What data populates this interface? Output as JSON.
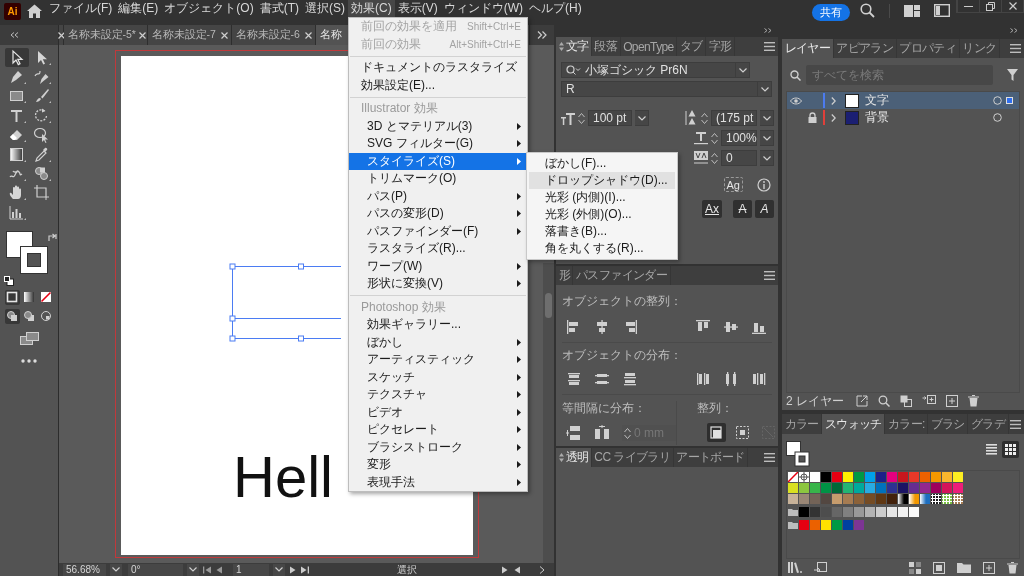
{
  "app": {
    "logo": "Ai"
  },
  "menu_bar": [
    {
      "label": "ファイル(F)",
      "selected": false
    },
    {
      "label": "編集(E)",
      "selected": false
    },
    {
      "label": "オブジェクト(O)",
      "selected": false
    },
    {
      "label": "書式(T)",
      "selected": false
    },
    {
      "label": "選択(S)",
      "selected": false
    },
    {
      "label": "効果(C)",
      "selected": true
    },
    {
      "label": "表示(V)",
      "selected": false
    },
    {
      "label": "ウィンドウ(W)",
      "selected": false
    },
    {
      "label": "ヘルプ(H)",
      "selected": false
    }
  ],
  "share_button": "共有",
  "tools": [
    {
      "kind": "selection",
      "selected": true
    },
    {
      "kind": "direct-selection",
      "selected": false
    },
    {
      "kind": "pen",
      "selected": false
    },
    {
      "kind": "curvature",
      "selected": false
    },
    {
      "kind": "rectangle",
      "selected": false
    },
    {
      "kind": "paintbrush",
      "selected": false
    },
    {
      "kind": "type",
      "selected": false
    },
    {
      "kind": "rotate",
      "selected": false
    },
    {
      "kind": "eraser",
      "selected": false
    },
    {
      "kind": "shaper",
      "selected": false
    },
    {
      "kind": "gradient",
      "selected": false
    },
    {
      "kind": "eyedropper",
      "selected": false
    },
    {
      "kind": "puppet-warp",
      "selected": false
    },
    {
      "kind": "shape-builder",
      "selected": false
    },
    {
      "kind": "hand",
      "selected": false
    },
    {
      "kind": "artboard",
      "selected": false
    },
    {
      "kind": "graph",
      "selected": false
    }
  ],
  "color_modes": [
    {
      "kind": "color",
      "selected": true
    },
    {
      "kind": "gradient",
      "selected": false
    },
    {
      "kind": "none",
      "selected": false
    }
  ],
  "draw_modes": [
    {
      "kind": "normal",
      "selected": true
    },
    {
      "kind": "behind",
      "selected": false
    },
    {
      "kind": "inside",
      "selected": false
    }
  ],
  "document_tabs": [
    {
      "label": "名称未設定-5*",
      "selected": false
    },
    {
      "label": "名称未設定-7",
      "selected": false
    },
    {
      "label": "名称未設定-6",
      "selected": false
    },
    {
      "label": "名称",
      "selected": true
    }
  ],
  "artboard": {
    "text": "Hell"
  },
  "status_bar": {
    "zoom": "56.68%",
    "rotation": "0°",
    "artboard": "1",
    "tool": "選択"
  },
  "effect_menu": {
    "sections": [
      {
        "items": [
          {
            "label": "前回の効果を適用",
            "shortcut": "Shift+Ctrl+E",
            "disabled": true,
            "submenu": false,
            "selected": false
          },
          {
            "label": "前回の効果",
            "shortcut": "Alt+Shift+Ctrl+E",
            "disabled": true,
            "submenu": false,
            "selected": false
          }
        ]
      },
      {
        "items": [
          {
            "label": "ドキュメントのラスタライズ効果設定(E)...",
            "disabled": false,
            "submenu": false,
            "selected": false
          }
        ]
      },
      {
        "header": "Illustrator 効果",
        "items": [
          {
            "label": "3D とマテリアル(3)",
            "disabled": false,
            "submenu": true,
            "selected": false
          },
          {
            "label": "SVG フィルター(G)",
            "disabled": false,
            "submenu": true,
            "selected": false
          },
          {
            "label": "スタイライズ(S)",
            "disabled": false,
            "submenu": true,
            "selected": true
          },
          {
            "label": "トリムマーク(O)",
            "disabled": false,
            "submenu": false,
            "selected": false
          },
          {
            "label": "パス(P)",
            "disabled": false,
            "submenu": true,
            "selected": false
          },
          {
            "label": "パスの変形(D)",
            "disabled": false,
            "submenu": true,
            "selected": false
          },
          {
            "label": "パスファインダー(F)",
            "disabled": false,
            "submenu": true,
            "selected": false
          },
          {
            "label": "ラスタライズ(R)...",
            "disabled": false,
            "submenu": false,
            "selected": false
          },
          {
            "label": "ワープ(W)",
            "disabled": false,
            "submenu": true,
            "selected": false
          },
          {
            "label": "形状に変換(V)",
            "disabled": false,
            "submenu": true,
            "selected": false
          }
        ]
      },
      {
        "header": "Photoshop 効果",
        "items": [
          {
            "label": "効果ギャラリー...",
            "disabled": false,
            "submenu": false,
            "selected": false
          },
          {
            "label": "ぼかし",
            "disabled": false,
            "submenu": true,
            "selected": false
          },
          {
            "label": "アーティスティック",
            "disabled": false,
            "submenu": true,
            "selected": false
          },
          {
            "label": "スケッチ",
            "disabled": false,
            "submenu": true,
            "selected": false
          },
          {
            "label": "テクスチャ",
            "disabled": false,
            "submenu": true,
            "selected": false
          },
          {
            "label": "ビデオ",
            "disabled": false,
            "submenu": true,
            "selected": false
          },
          {
            "label": "ピクセレート",
            "disabled": false,
            "submenu": true,
            "selected": false
          },
          {
            "label": "ブラシストローク",
            "disabled": false,
            "submenu": true,
            "selected": false
          },
          {
            "label": "変形",
            "disabled": false,
            "submenu": true,
            "selected": false
          },
          {
            "label": "表現手法",
            "disabled": false,
            "submenu": true,
            "selected": false
          }
        ]
      }
    ],
    "submenu": [
      {
        "label": "ぼかし(F)...",
        "selected": false
      },
      {
        "label": "ドロップシャドウ(D)...",
        "selected": true
      },
      {
        "label": "光彩 (内側)(I)...",
        "selected": false
      },
      {
        "label": "光彩 (外側)(O)...",
        "selected": false
      },
      {
        "label": "落書き(B)...",
        "selected": false
      },
      {
        "label": "角を丸くする(R)...",
        "selected": false
      }
    ]
  },
  "character_panel": {
    "tabs": [
      {
        "label": "文字",
        "selected": true
      },
      {
        "label": "段落",
        "selected": false
      },
      {
        "label": "OpenType",
        "selected": false
      },
      {
        "label": "タブ",
        "selected": false
      },
      {
        "label": "字形",
        "selected": false
      }
    ],
    "font_family": "小塚ゴシック Pr6N",
    "font_style": "R",
    "font_size": "100 pt",
    "leading": "(175 pt",
    "vertical_scale": "100%",
    "tracking": "0",
    "glyph_button": "Ag",
    "style_buttons": [
      {
        "kind": "underline",
        "label": "Ax"
      },
      {
        "kind": "slash",
        "label": "A"
      },
      {
        "kind": "italic",
        "label": "A"
      }
    ]
  },
  "align_panel": {
    "tabs": [
      {
        "label": "形",
        "selected": false
      },
      {
        "label": "パスファインダー",
        "selected": false
      }
    ],
    "align_label": "オブジェクトの整列：",
    "distribute_label": "オブジェクトの分布：",
    "spacing_label": "等間隔に分布：",
    "spacing_value": "0 mm",
    "spacing_disabled": true,
    "align_to_label": "整列：",
    "align_to": [
      {
        "kind": "selection",
        "selected": true,
        "disabled": false
      },
      {
        "kind": "artboard",
        "selected": false,
        "disabled": false
      },
      {
        "kind": "key-object",
        "selected": false,
        "disabled": true
      }
    ]
  },
  "transparency_panel": {
    "tabs": [
      {
        "label": "透明",
        "selected": true
      },
      {
        "label": "CC ライブラリ",
        "selected": false
      },
      {
        "label": "アートボード",
        "selected": false
      }
    ]
  },
  "layers_panel": {
    "tabs": [
      {
        "label": "レイヤー",
        "selected": true
      },
      {
        "label": "アピアラン",
        "selected": false
      },
      {
        "label": "プロパティ",
        "selected": false
      },
      {
        "label": "リンク",
        "selected": false
      }
    ],
    "search": {
      "placeholder": "すべてを検索"
    },
    "layers": [
      {
        "name": "文字",
        "color": "#4c7bef",
        "kind": "text",
        "visible": true,
        "locked": false,
        "selected": true
      },
      {
        "name": "背景",
        "color": "#e0403a",
        "kind": "fill",
        "visible": false,
        "locked": true,
        "selected": false
      }
    ],
    "count": "2 レイヤー"
  },
  "swatches_panel": {
    "tabs": [
      {
        "label": "カラー",
        "selected": false
      },
      {
        "label": "スウォッチ",
        "selected": true
      },
      {
        "label": "カラー:",
        "selected": false
      },
      {
        "label": "ブラシ",
        "selected": false
      },
      {
        "label": "グラデ",
        "selected": false
      }
    ],
    "view_modes": [
      {
        "kind": "list",
        "selected": false
      },
      {
        "kind": "grid",
        "selected": true
      }
    ],
    "rows": [
      {
        "kind": "default",
        "swatches": [
          {
            "kind": "none"
          },
          {
            "kind": "registration"
          },
          {
            "kind": "color",
            "color": "#ffffff"
          },
          {
            "kind": "color",
            "color": "#000000"
          },
          {
            "kind": "color",
            "color": "#e60012"
          },
          {
            "kind": "color",
            "color": "#fff100"
          },
          {
            "kind": "color",
            "color": "#009944"
          },
          {
            "kind": "color",
            "color": "#00a0e9"
          },
          {
            "kind": "color",
            "color": "#1d2088"
          },
          {
            "kind": "color",
            "color": "#e4007f"
          },
          {
            "kind": "color",
            "color": "#c9161d"
          },
          {
            "kind": "color",
            "color": "#e83828"
          },
          {
            "kind": "color",
            "color": "#eb6100"
          },
          {
            "kind": "color",
            "color": "#f39800"
          },
          {
            "kind": "color",
            "color": "#f8b62d"
          },
          {
            "kind": "color",
            "color": "#fcee21"
          }
        ]
      },
      {
        "kind": "default",
        "swatches": [
          {
            "kind": "color",
            "color": "#d9e021"
          },
          {
            "kind": "color",
            "color": "#8cc63f"
          },
          {
            "kind": "color",
            "color": "#39b54a"
          },
          {
            "kind": "color",
            "color": "#009245"
          },
          {
            "kind": "color",
            "color": "#006837"
          },
          {
            "kind": "color",
            "color": "#22b573"
          },
          {
            "kind": "color",
            "color": "#00a99d"
          },
          {
            "kind": "color",
            "color": "#29abe2"
          },
          {
            "kind": "color",
            "color": "#0071bc"
          },
          {
            "kind": "color",
            "color": "#2e3192"
          },
          {
            "kind": "color",
            "color": "#1b1464"
          },
          {
            "kind": "color",
            "color": "#662d91"
          },
          {
            "kind": "color",
            "color": "#93278f"
          },
          {
            "kind": "color",
            "color": "#9e005d"
          },
          {
            "kind": "color",
            "color": "#d4145a"
          },
          {
            "kind": "color",
            "color": "#ed1e79"
          }
        ]
      },
      {
        "kind": "default",
        "swatches": [
          {
            "kind": "color",
            "color": "#c7b299"
          },
          {
            "kind": "color",
            "color": "#998675"
          },
          {
            "kind": "color",
            "color": "#736357"
          },
          {
            "kind": "color",
            "color": "#534741"
          },
          {
            "kind": "color",
            "color": "#c69c6d"
          },
          {
            "kind": "color",
            "color": "#a67c52"
          },
          {
            "kind": "color",
            "color": "#8c6239"
          },
          {
            "kind": "color",
            "color": "#754c24"
          },
          {
            "kind": "color",
            "color": "#603813"
          },
          {
            "kind": "color",
            "color": "#42210b"
          },
          {
            "kind": "gradient",
            "color": "#000000"
          },
          {
            "kind": "gradient",
            "color": "#f39800"
          },
          {
            "kind": "gradient",
            "color": "#1e6fc0"
          },
          {
            "kind": "pattern",
            "color": "#1e1e1e"
          },
          {
            "kind": "pattern",
            "color": "#7ac143"
          },
          {
            "kind": "pattern",
            "color": "#a67c52"
          }
        ]
      },
      {
        "kind": "group",
        "swatches": [
          {
            "kind": "color",
            "color": "#000000"
          },
          {
            "kind": "color",
            "color": "#333333"
          },
          {
            "kind": "color",
            "color": "#4d4d4d"
          },
          {
            "kind": "color",
            "color": "#666666"
          },
          {
            "kind": "color",
            "color": "#808080"
          },
          {
            "kind": "color",
            "color": "#999999"
          },
          {
            "kind": "color",
            "color": "#b3b3b3"
          },
          {
            "kind": "color",
            "color": "#cccccc"
          },
          {
            "kind": "color",
            "color": "#e6e6e6"
          },
          {
            "kind": "color",
            "color": "#f2f2f2"
          },
          {
            "kind": "color",
            "color": "#fafafa"
          }
        ]
      },
      {
        "kind": "group",
        "swatches": [
          {
            "kind": "color",
            "color": "#e60012"
          },
          {
            "kind": "color",
            "color": "#eb6100"
          },
          {
            "kind": "color",
            "color": "#ffe100"
          },
          {
            "kind": "color",
            "color": "#009944"
          },
          {
            "kind": "color",
            "color": "#0040a0"
          },
          {
            "kind": "color",
            "color": "#7d3594"
          }
        ]
      }
    ]
  }
}
